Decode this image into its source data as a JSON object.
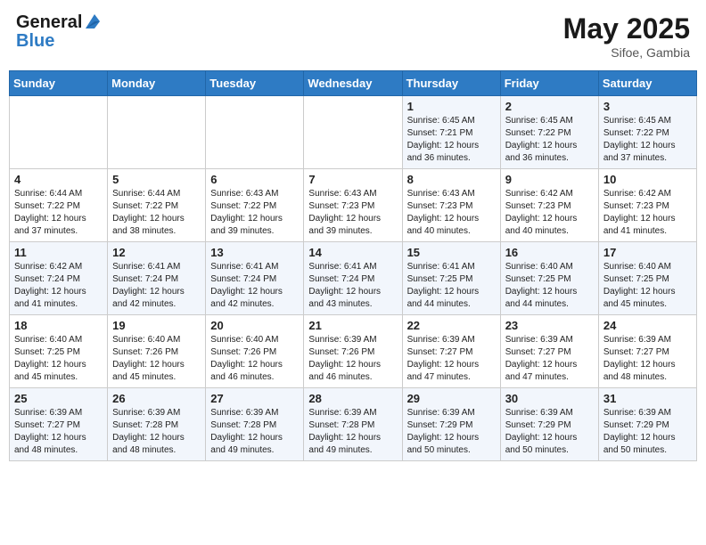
{
  "header": {
    "logo_general": "General",
    "logo_blue": "Blue",
    "month_title": "May 2025",
    "location": "Sifoe, Gambia"
  },
  "days_of_week": [
    "Sunday",
    "Monday",
    "Tuesday",
    "Wednesday",
    "Thursday",
    "Friday",
    "Saturday"
  ],
  "weeks": [
    [
      {
        "day": "",
        "info": ""
      },
      {
        "day": "",
        "info": ""
      },
      {
        "day": "",
        "info": ""
      },
      {
        "day": "",
        "info": ""
      },
      {
        "day": "1",
        "info": "Sunrise: 6:45 AM\nSunset: 7:21 PM\nDaylight: 12 hours and 36 minutes."
      },
      {
        "day": "2",
        "info": "Sunrise: 6:45 AM\nSunset: 7:22 PM\nDaylight: 12 hours and 36 minutes."
      },
      {
        "day": "3",
        "info": "Sunrise: 6:45 AM\nSunset: 7:22 PM\nDaylight: 12 hours and 37 minutes."
      }
    ],
    [
      {
        "day": "4",
        "info": "Sunrise: 6:44 AM\nSunset: 7:22 PM\nDaylight: 12 hours and 37 minutes."
      },
      {
        "day": "5",
        "info": "Sunrise: 6:44 AM\nSunset: 7:22 PM\nDaylight: 12 hours and 38 minutes."
      },
      {
        "day": "6",
        "info": "Sunrise: 6:43 AM\nSunset: 7:22 PM\nDaylight: 12 hours and 39 minutes."
      },
      {
        "day": "7",
        "info": "Sunrise: 6:43 AM\nSunset: 7:23 PM\nDaylight: 12 hours and 39 minutes."
      },
      {
        "day": "8",
        "info": "Sunrise: 6:43 AM\nSunset: 7:23 PM\nDaylight: 12 hours and 40 minutes."
      },
      {
        "day": "9",
        "info": "Sunrise: 6:42 AM\nSunset: 7:23 PM\nDaylight: 12 hours and 40 minutes."
      },
      {
        "day": "10",
        "info": "Sunrise: 6:42 AM\nSunset: 7:23 PM\nDaylight: 12 hours and 41 minutes."
      }
    ],
    [
      {
        "day": "11",
        "info": "Sunrise: 6:42 AM\nSunset: 7:24 PM\nDaylight: 12 hours and 41 minutes."
      },
      {
        "day": "12",
        "info": "Sunrise: 6:41 AM\nSunset: 7:24 PM\nDaylight: 12 hours and 42 minutes."
      },
      {
        "day": "13",
        "info": "Sunrise: 6:41 AM\nSunset: 7:24 PM\nDaylight: 12 hours and 42 minutes."
      },
      {
        "day": "14",
        "info": "Sunrise: 6:41 AM\nSunset: 7:24 PM\nDaylight: 12 hours and 43 minutes."
      },
      {
        "day": "15",
        "info": "Sunrise: 6:41 AM\nSunset: 7:25 PM\nDaylight: 12 hours and 44 minutes."
      },
      {
        "day": "16",
        "info": "Sunrise: 6:40 AM\nSunset: 7:25 PM\nDaylight: 12 hours and 44 minutes."
      },
      {
        "day": "17",
        "info": "Sunrise: 6:40 AM\nSunset: 7:25 PM\nDaylight: 12 hours and 45 minutes."
      }
    ],
    [
      {
        "day": "18",
        "info": "Sunrise: 6:40 AM\nSunset: 7:25 PM\nDaylight: 12 hours and 45 minutes."
      },
      {
        "day": "19",
        "info": "Sunrise: 6:40 AM\nSunset: 7:26 PM\nDaylight: 12 hours and 45 minutes."
      },
      {
        "day": "20",
        "info": "Sunrise: 6:40 AM\nSunset: 7:26 PM\nDaylight: 12 hours and 46 minutes."
      },
      {
        "day": "21",
        "info": "Sunrise: 6:39 AM\nSunset: 7:26 PM\nDaylight: 12 hours and 46 minutes."
      },
      {
        "day": "22",
        "info": "Sunrise: 6:39 AM\nSunset: 7:27 PM\nDaylight: 12 hours and 47 minutes."
      },
      {
        "day": "23",
        "info": "Sunrise: 6:39 AM\nSunset: 7:27 PM\nDaylight: 12 hours and 47 minutes."
      },
      {
        "day": "24",
        "info": "Sunrise: 6:39 AM\nSunset: 7:27 PM\nDaylight: 12 hours and 48 minutes."
      }
    ],
    [
      {
        "day": "25",
        "info": "Sunrise: 6:39 AM\nSunset: 7:27 PM\nDaylight: 12 hours and 48 minutes."
      },
      {
        "day": "26",
        "info": "Sunrise: 6:39 AM\nSunset: 7:28 PM\nDaylight: 12 hours and 48 minutes."
      },
      {
        "day": "27",
        "info": "Sunrise: 6:39 AM\nSunset: 7:28 PM\nDaylight: 12 hours and 49 minutes."
      },
      {
        "day": "28",
        "info": "Sunrise: 6:39 AM\nSunset: 7:28 PM\nDaylight: 12 hours and 49 minutes."
      },
      {
        "day": "29",
        "info": "Sunrise: 6:39 AM\nSunset: 7:29 PM\nDaylight: 12 hours and 50 minutes."
      },
      {
        "day": "30",
        "info": "Sunrise: 6:39 AM\nSunset: 7:29 PM\nDaylight: 12 hours and 50 minutes."
      },
      {
        "day": "31",
        "info": "Sunrise: 6:39 AM\nSunset: 7:29 PM\nDaylight: 12 hours and 50 minutes."
      }
    ]
  ]
}
